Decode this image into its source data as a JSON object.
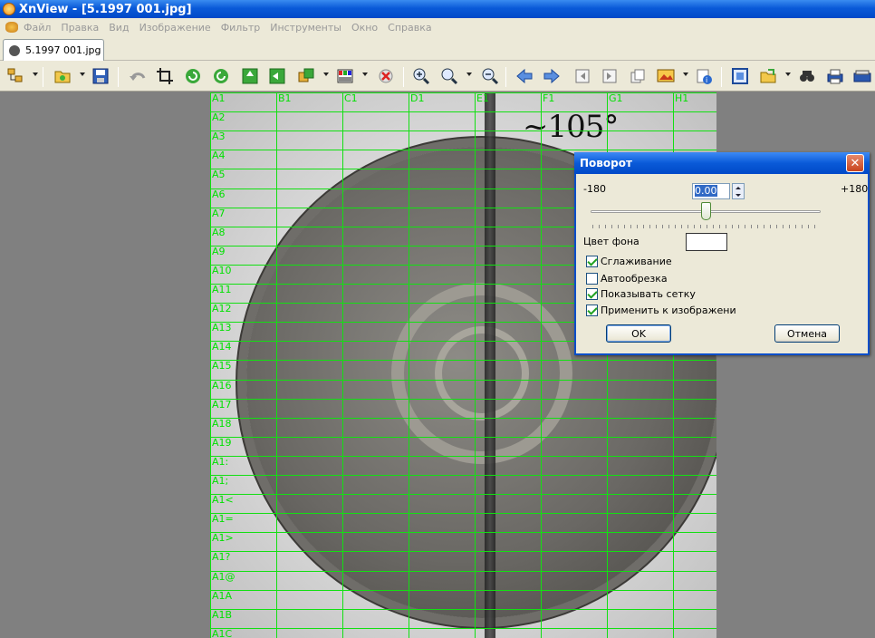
{
  "window": {
    "title": "XnView - [5.1997 001.jpg]"
  },
  "menu": [
    "Файл",
    "Правка",
    "Вид",
    "Изображение",
    "Фильтр",
    "Инструменты",
    "Окно",
    "Справка"
  ],
  "tab": {
    "label": "5.1997 001.jpg"
  },
  "image": {
    "angle_note": "~105°"
  },
  "grid": {
    "columns": [
      "A1",
      "B1",
      "C1",
      "D1",
      "E1",
      "F1",
      "G1",
      "H1"
    ],
    "rows": [
      "A1",
      "A2",
      "A3",
      "A4",
      "A5",
      "A6",
      "A7",
      "A8",
      "A9",
      "A10",
      "A11",
      "A12",
      "A13",
      "A14",
      "A15",
      "A16",
      "A17",
      "A18",
      "A19",
      "A1:",
      "A1;",
      "A1<",
      "A1=",
      "A1>",
      "A1?",
      "A1@",
      "A1A",
      "A1B",
      "A1C"
    ],
    "color": "#12e012"
  },
  "dialog": {
    "title": "Поворот",
    "min_label": "-180",
    "max_label": "+180",
    "angle_value": "0.00",
    "slider_value": 0,
    "bg_color_label": "Цвет фона",
    "bg_color": "#ffffff",
    "checkboxes": [
      {
        "label": "Сглаживание",
        "checked": true
      },
      {
        "label": "Автообрезка",
        "checked": false
      },
      {
        "label": "Показывать сетку",
        "checked": true
      },
      {
        "label": "Применить к изображени",
        "checked": true
      }
    ],
    "ok_label": "OK",
    "cancel_label": "Отмена"
  },
  "toolbar_icons": [
    "browser-icon",
    "open-icon",
    "save-icon",
    "undo-icon",
    "crop-icon",
    "rotate-left-icon",
    "rotate-right-icon",
    "flip-icon",
    "mirror-icon",
    "convert-icon",
    "palette-icon",
    "remove-icon",
    "zoom-in-icon",
    "zoom-fit-icon",
    "zoom-out-icon",
    "prev-icon",
    "next-icon",
    "first-page-icon",
    "prev-page-icon",
    "next-page-icon",
    "slideshow-icon",
    "properties-icon",
    "fullscreen-icon",
    "export-icon",
    "find-icon",
    "print-icon",
    "scanner-icon"
  ]
}
